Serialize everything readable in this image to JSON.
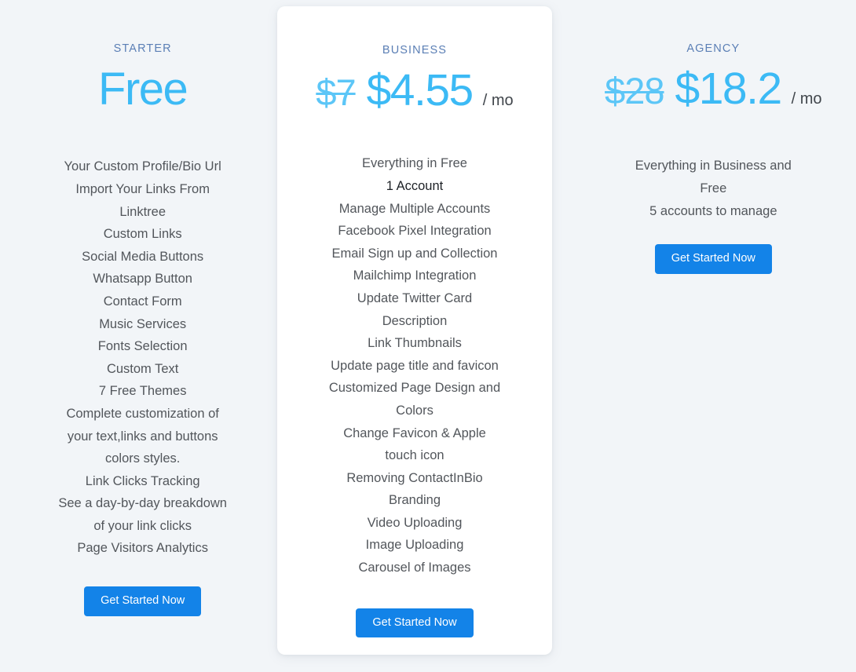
{
  "theme": {
    "page_background": "#f2f5f8",
    "card_background": "#ffffff",
    "label_color": "#5b7fb5",
    "price_color": "#3cbaf5",
    "old_price_color": "#5cc6f7",
    "button_color": "#1383e8",
    "feature_text_color": "#52565b"
  },
  "plans": {
    "starter": {
      "label": "STARTER",
      "price": "Free",
      "features": [
        "Your Custom Profile/Bio Url",
        "Import Your Links From",
        "Linktree",
        "Custom Links",
        "Social Media Buttons",
        "Whatsapp Button",
        "Contact Form",
        "Music Services",
        "Fonts Selection",
        "Custom Text",
        "7 Free Themes",
        "Complete customization of",
        "your text,links and buttons",
        "colors styles.",
        "Link Clicks Tracking",
        "See a day-by-day breakdown",
        "of your link clicks",
        "Page Visitors Analytics"
      ],
      "cta_label": "Get Started Now"
    },
    "business": {
      "label": "BUSINESS",
      "old_price": "$7",
      "price": "$4.55",
      "period": "/ mo",
      "features": [
        "Everything in Free",
        "1 Account",
        "Manage Multiple Accounts",
        "Facebook Pixel Integration",
        "Email Sign up and Collection",
        "Mailchimp Integration",
        "Update Twitter Card",
        "Description",
        "Link Thumbnails",
        "Update page title and favicon",
        "Customized Page Design and",
        "Colors",
        "Change Favicon & Apple",
        "touch icon",
        "Removing ContactInBio",
        "Branding",
        "Video Uploading",
        "Image Uploading",
        "Carousel of Images"
      ],
      "emphasis_index": 1,
      "cta_label": "Get Started Now"
    },
    "agency": {
      "label": "AGENCY",
      "old_price": "$28",
      "price": "$18.2",
      "period": "/ mo",
      "features": [
        "Everything in Business and",
        "Free",
        "5 accounts to manage"
      ],
      "cta_label": "Get Started Now"
    }
  }
}
